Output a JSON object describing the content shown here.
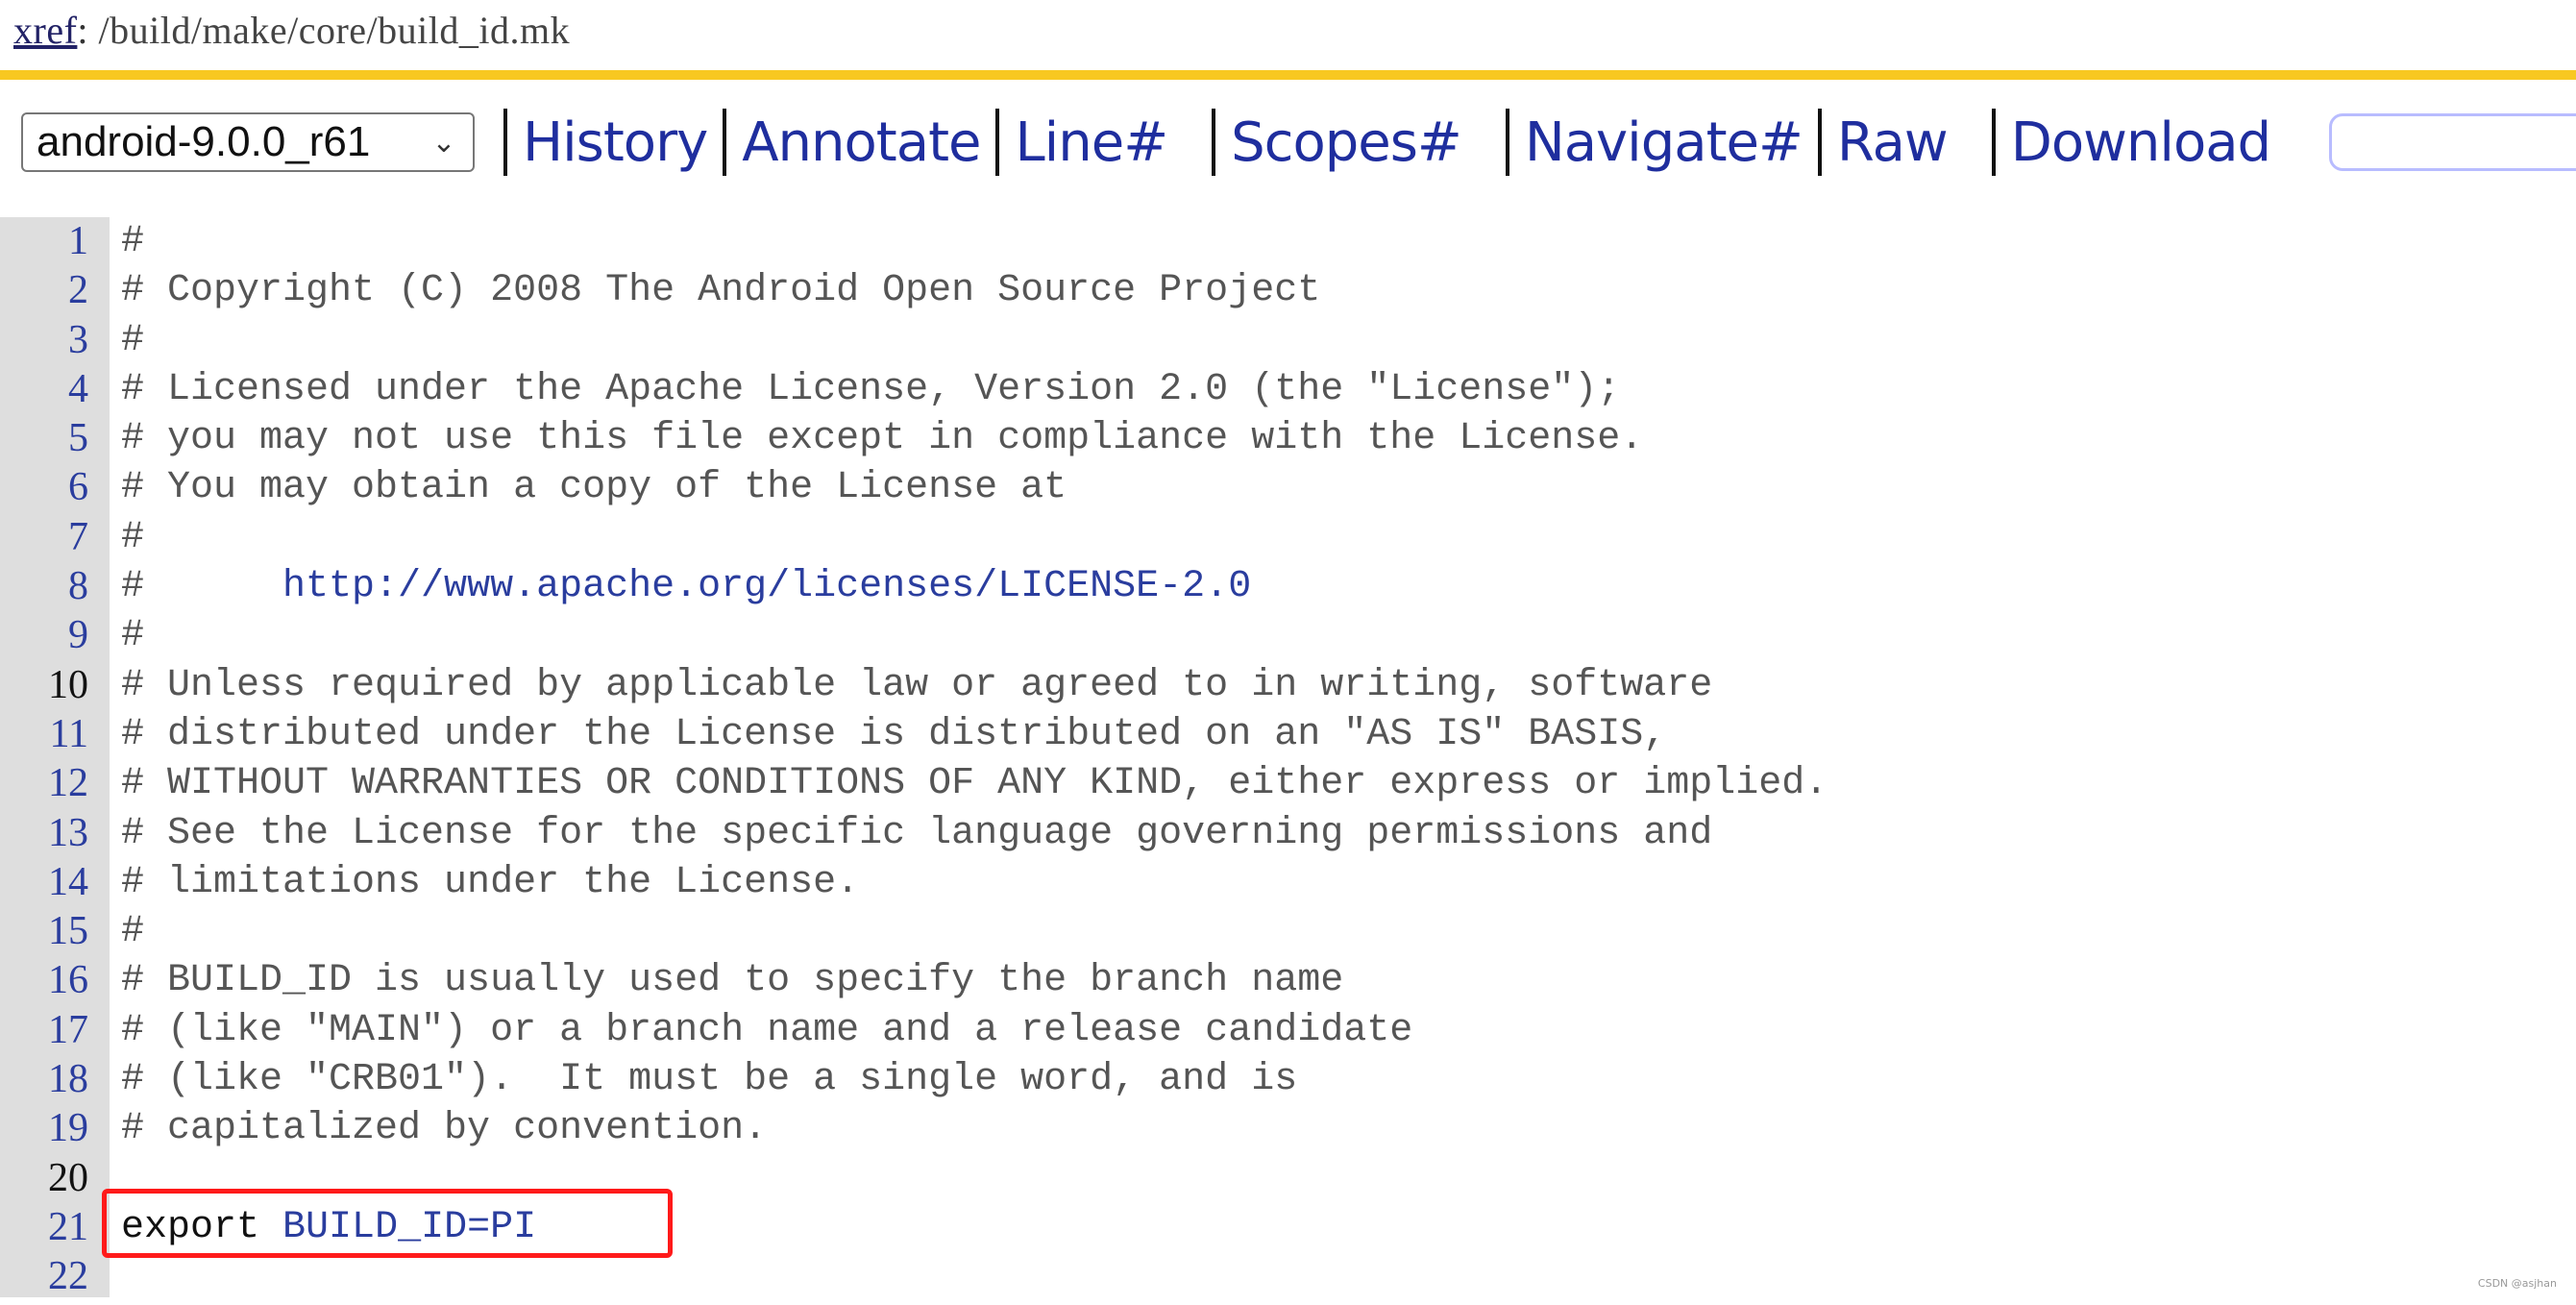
{
  "breadcrumb": {
    "link_label": "xref",
    "separator": ":",
    "path": " /build/make/core/build_id.mk"
  },
  "toolbar": {
    "branch_select": {
      "value": "android-9.0.0_r61",
      "icon": "chevron-down-icon"
    },
    "links": [
      {
        "label": "History"
      },
      {
        "label": "Annotate"
      },
      {
        "label": "Line#"
      },
      {
        "label": "Scopes#"
      },
      {
        "label": "Navigate#"
      },
      {
        "label": "Raw"
      },
      {
        "label": "Download"
      }
    ],
    "search_input": {
      "value": "",
      "placeholder": ""
    }
  },
  "code": {
    "lines": [
      {
        "n": "1",
        "text": "#"
      },
      {
        "n": "2",
        "text": "# Copyright (C) 2008 The Android Open Source Project"
      },
      {
        "n": "3",
        "text": "#"
      },
      {
        "n": "4",
        "text": "# Licensed under the Apache License, Version 2.0 (the \"License\");"
      },
      {
        "n": "5",
        "text": "# you may not use this file except in compliance with the License."
      },
      {
        "n": "6",
        "text": "# You may obtain a copy of the License at"
      },
      {
        "n": "7",
        "text": "#"
      },
      {
        "n": "8",
        "text": "#      ",
        "url": "http://www.apache.org/licenses/LICENSE-2.0"
      },
      {
        "n": "9",
        "text": "#"
      },
      {
        "n": "10",
        "text": "# Unless required by applicable law or agreed to in writing, software"
      },
      {
        "n": "11",
        "text": "# distributed under the License is distributed on an \"AS IS\" BASIS,"
      },
      {
        "n": "12",
        "text": "# WITHOUT WARRANTIES OR CONDITIONS OF ANY KIND, either express or implied."
      },
      {
        "n": "13",
        "text": "# See the License for the specific language governing permissions and"
      },
      {
        "n": "14",
        "text": "# limitations under the License."
      },
      {
        "n": "15",
        "text": "#"
      },
      {
        "n": "16",
        "text": "# BUILD_ID is usually used to specify the branch name"
      },
      {
        "n": "17",
        "text": "# (like \"MAIN\") or a branch name and a release candidate"
      },
      {
        "n": "18",
        "text": "# (like \"CRB01\").  It must be a single word, and is"
      },
      {
        "n": "19",
        "text": "# capitalized by convention."
      },
      {
        "n": "20",
        "text": ""
      },
      {
        "n": "21",
        "keyword": "export",
        "ident": "BUILD_ID=PI"
      },
      {
        "n": "22",
        "text": ""
      }
    ],
    "dark_line_numbers": [
      "10",
      "20"
    ],
    "highlighted_line": "21"
  },
  "colors": {
    "accent_bar": "#f8c821",
    "link": "#1f2e9e",
    "highlight_box": "#ff1a1a"
  },
  "watermark": "CSDN @asjhan"
}
